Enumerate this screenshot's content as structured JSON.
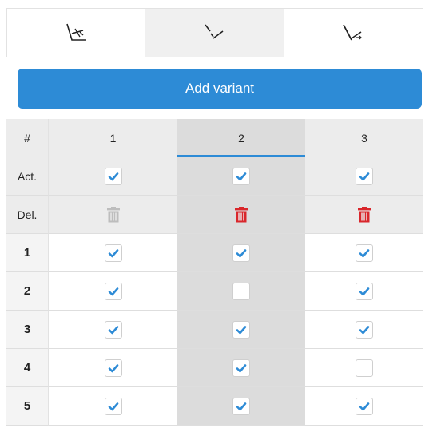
{
  "tabs": [
    {
      "icon": "angle-measure-icon",
      "active": false
    },
    {
      "icon": "dash-line-icon",
      "active": true
    },
    {
      "icon": "slash-arrow-icon",
      "active": false
    }
  ],
  "add_button_label": "Add variant",
  "header": {
    "hash": "#",
    "cols": [
      "1",
      "2",
      "3"
    ],
    "selected_col": 2
  },
  "sub_rows": {
    "act_label": "Act.",
    "del_label": "Del.",
    "act": [
      true,
      true,
      true
    ],
    "del_enabled": [
      false,
      true,
      true
    ]
  },
  "rows": [
    {
      "label": "1",
      "checks": [
        true,
        true,
        true
      ]
    },
    {
      "label": "2",
      "checks": [
        true,
        false,
        true
      ]
    },
    {
      "label": "3",
      "checks": [
        true,
        true,
        true
      ]
    },
    {
      "label": "4",
      "checks": [
        true,
        true,
        false
      ]
    },
    {
      "label": "5",
      "checks": [
        true,
        true,
        true
      ]
    }
  ],
  "colors": {
    "accent": "#2d8bd6",
    "delete_active": "#d9262b",
    "delete_disabled": "#bdbdbd"
  }
}
